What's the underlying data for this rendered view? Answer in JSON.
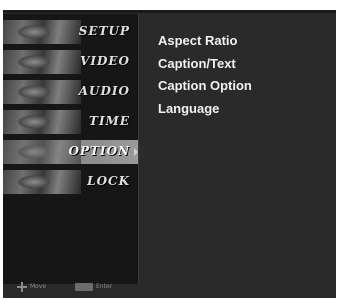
{
  "menu": {
    "items": [
      {
        "label": "SETUP",
        "thumb_icon": "satellite-dish-icon"
      },
      {
        "label": "VIDEO",
        "thumb_icon": "film-icon"
      },
      {
        "label": "AUDIO",
        "thumb_icon": "speaker-icon"
      },
      {
        "label": "TIME",
        "thumb_icon": "clock-icon"
      },
      {
        "label": "OPTION",
        "thumb_icon": "option-icon",
        "selected": true
      },
      {
        "label": "LOCK",
        "thumb_icon": "lock-icon"
      }
    ]
  },
  "submenu": {
    "items": [
      {
        "label": "Aspect Ratio"
      },
      {
        "label": "Caption/Text"
      },
      {
        "label": "Caption Option"
      },
      {
        "label": "Language"
      }
    ]
  },
  "nav_hints": {
    "move_label": "Move",
    "enter_label": "Enter"
  },
  "colors": {
    "background": "#2a2a2a",
    "menu_background": "#161616",
    "selected_highlight": "#8a8a8a",
    "text": "#f2f2f2"
  }
}
